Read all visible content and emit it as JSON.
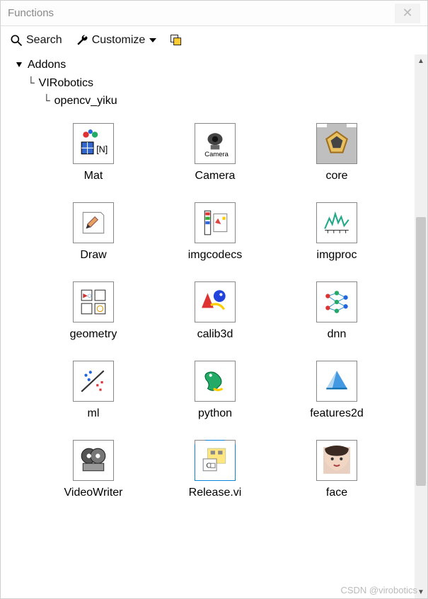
{
  "window": {
    "title": "Functions"
  },
  "toolbar": {
    "search_label": "Search",
    "customize_label": "Customize"
  },
  "tree": {
    "root": "Addons",
    "child1": "VIRobotics",
    "child2": "opencv_yiku"
  },
  "palette": [
    {
      "label": "Mat",
      "icon": "mat-icon",
      "selected": false
    },
    {
      "label": "Camera",
      "icon": "camera-icon",
      "selected": false
    },
    {
      "label": "core",
      "icon": "core-icon",
      "selected": false
    },
    {
      "label": "Draw",
      "icon": "draw-icon",
      "selected": false
    },
    {
      "label": "imgcodecs",
      "icon": "imgcodecs-icon",
      "selected": false
    },
    {
      "label": "imgproc",
      "icon": "imgproc-icon",
      "selected": false
    },
    {
      "label": "geometry",
      "icon": "geometry-icon",
      "selected": false
    },
    {
      "label": "calib3d",
      "icon": "calib3d-icon",
      "selected": false
    },
    {
      "label": "dnn",
      "icon": "dnn-icon",
      "selected": false
    },
    {
      "label": "ml",
      "icon": "ml-icon",
      "selected": false
    },
    {
      "label": "python",
      "icon": "python-icon",
      "selected": false
    },
    {
      "label": "features2d",
      "icon": "features2d-icon",
      "selected": false
    },
    {
      "label": "VideoWriter",
      "icon": "videowriter-icon",
      "selected": false
    },
    {
      "label": "Release.vi",
      "icon": "release-icon",
      "selected": true
    },
    {
      "label": "face",
      "icon": "face-icon",
      "selected": false
    }
  ],
  "watermark": "CSDN @virobotics"
}
